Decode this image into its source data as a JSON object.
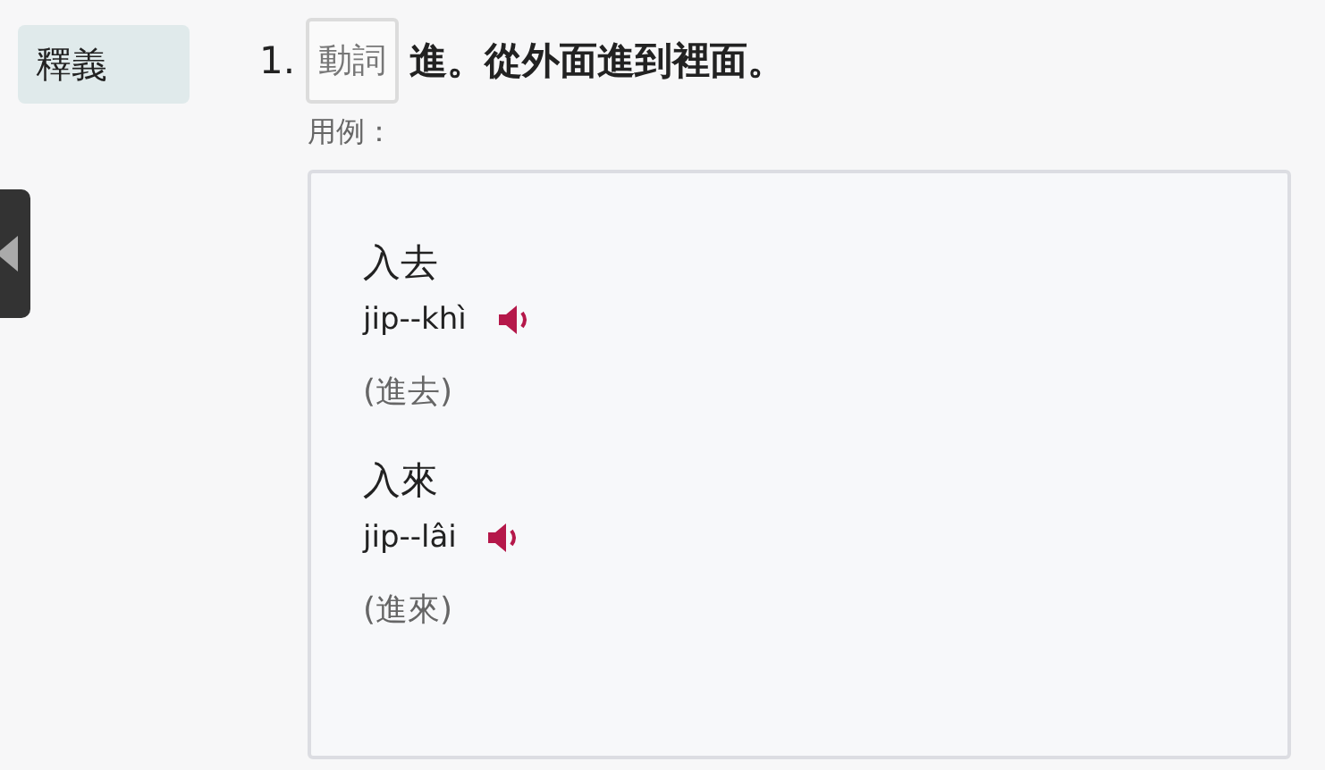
{
  "section_label": "釋義",
  "definitions": [
    {
      "number": "1.",
      "part_of_speech": "動詞",
      "text": "進。從外面進到裡面。",
      "examples_label": "用例：",
      "examples": [
        {
          "hanji": "入去",
          "romanization": "jip--khì",
          "translation": "(進去)"
        },
        {
          "hanji": "入來",
          "romanization": "jip--lâi",
          "translation": "(進來)"
        }
      ]
    }
  ]
}
